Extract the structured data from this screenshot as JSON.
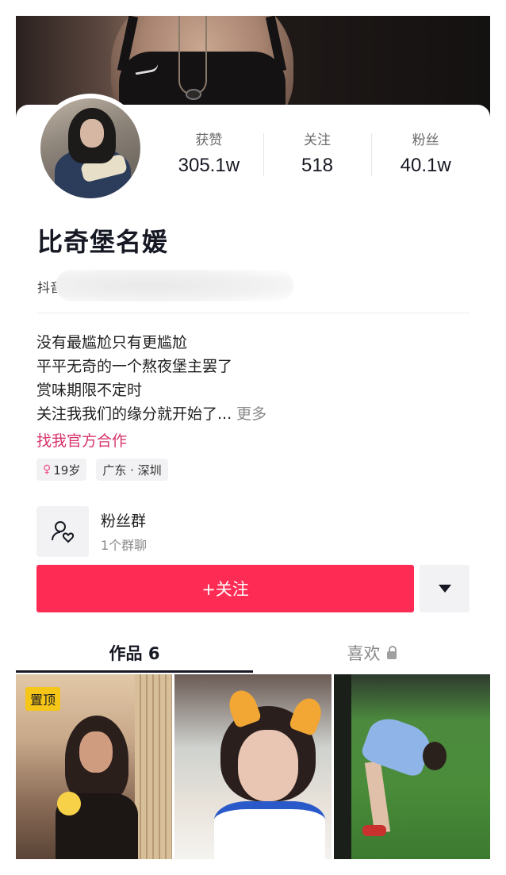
{
  "profile": {
    "nickname": "比奇堡名媛",
    "douyin_id_prefix": "抖音",
    "stats": [
      {
        "label": "获赞",
        "value": "305.1w"
      },
      {
        "label": "关注",
        "value": "518"
      },
      {
        "label": "粉丝",
        "value": "40.1w"
      }
    ],
    "bio_lines": [
      "没有最尴尬只有更尴尬",
      "平平无奇的一个熬夜堡主罢了",
      "赏味期限不定时",
      "关注我我们的缘分就开始了..."
    ],
    "bio_more": "更多",
    "collab_link": "找我官方合作",
    "tags": {
      "age_symbol": "♀",
      "age": "19岁",
      "location": "广东 · 深圳"
    }
  },
  "fan_group": {
    "title": "粉丝群",
    "subtitle": "1个群聊"
  },
  "actions": {
    "follow_label": "+关注"
  },
  "tabs": [
    {
      "label": "作品 6",
      "active": true
    },
    {
      "label": "喜欢",
      "active": false,
      "locked": true
    }
  ],
  "videos": [
    {
      "badge": "置顶"
    },
    {
      "badge": ""
    },
    {
      "badge": ""
    }
  ],
  "colors": {
    "accent": "#fe2c55",
    "link": "#d6336c",
    "pin_badge": "#f5c518"
  }
}
